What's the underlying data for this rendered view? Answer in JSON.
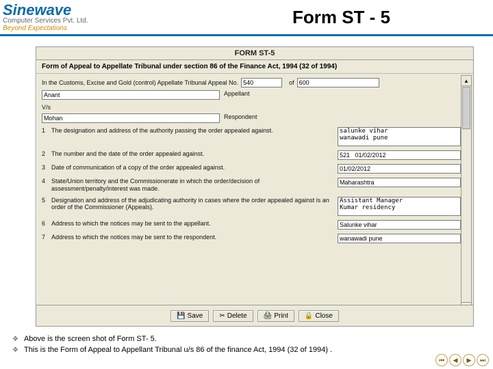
{
  "header": {
    "logo_main": "Sinewave",
    "logo_sub1": "Computer Services Pvt. Ltd.",
    "logo_sub2": "Beyond Expectations",
    "slide_title": "Form ST - 5"
  },
  "window": {
    "form_name": "FORM ST-5",
    "sub_title": "Form of Appeal to Appellate Tribunal under section 86 of the Finance Act, 1994 (32 of 1994)",
    "intro_line": "In the Customs, Excise and Gold (control) Appellate Tribunal Appeal No.",
    "appeal_no": "540",
    "of_label": "of",
    "appeal_year": "600",
    "appellant_value": "Anant",
    "appellant_label": "Appellant",
    "vs_label": "V/s",
    "respondent_value": "Mohan",
    "respondent_label": "Respondent",
    "rows": [
      {
        "n": "1",
        "lbl": "The designation and address of the authority passing the order appealed against.",
        "val": "salunke vihar\nwanawadi pune"
      },
      {
        "n": "2",
        "lbl": "The number and the date of the order appealed against.",
        "val": "521   01/02/2012"
      },
      {
        "n": "3",
        "lbl": "Date of communication of a copy of the order appealed against.",
        "val": "01/02/2012"
      },
      {
        "n": "4",
        "lbl": "State/Union territory and the Commissionerate in which the order/decision of assessment/penalty/interest was made.",
        "val": "Maharashtra"
      },
      {
        "n": "5",
        "lbl": "Designation and address of the adjudicating authority in cases where the order appealed against is an order of the Commissioner (Appeals).",
        "val": "Assistant Manager\nKumar residency"
      },
      {
        "n": "6",
        "lbl": "Address to which the notices may be sent to the appellant.",
        "val": "Salunke vihar"
      },
      {
        "n": "7",
        "lbl": "Address to which the notices may be sent to the respondent.",
        "val": "wanawadi pune"
      }
    ],
    "buttons": {
      "save": "Save",
      "delete": "Delete",
      "print": "Print",
      "close": "Close"
    }
  },
  "notes": [
    "Above is the screen shot of Form ST- 5.",
    "This is the Form of Appeal to Appellant Tribunal u/s 86 of the finance Act, 1994 (32 of 1994) ."
  ]
}
